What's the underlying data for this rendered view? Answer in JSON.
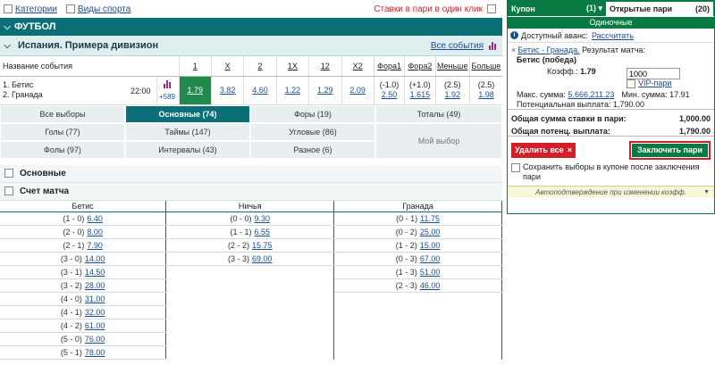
{
  "top": {
    "categories": "Категории",
    "sports": "Виды спорта",
    "one_click": "Ставки в пари в один клик"
  },
  "sport_header": "ФУТБОЛ",
  "league": {
    "title": "Испания. Примера дивизион",
    "all_events": "Все события"
  },
  "odds_table": {
    "headers": [
      "Название события",
      "1",
      "X",
      "2",
      "1X",
      "12",
      "X2",
      "Фора1",
      "Фора2",
      "Меньше",
      "Больше"
    ],
    "team1": "1. Бетис",
    "team2": "2. Гранада",
    "time": "22:00",
    "more_count": "+589",
    "odds": [
      "1.79",
      "3.82",
      "4.60",
      "1.22",
      "1.29",
      "2.09"
    ],
    "hc1_line": "(-1.0)",
    "hc1_val": "2.50",
    "hc2_line": "(+1.0)",
    "hc2_val": "1.615",
    "under_line": "(2.5)",
    "under_val": "1.92",
    "over_line": "(2.5)",
    "over_val": "1.98"
  },
  "market_tabs": [
    "Все выборы",
    "Основные (74)",
    "Форы (19)",
    "Тоталы (49)",
    "Голы (77)",
    "Таймы (147)",
    "Угловые (86)",
    "Мой выбор",
    "Фолы (97)",
    "Интервалы (43)",
    "Разное (6)"
  ],
  "markets": {
    "main": "Основные",
    "score": "Счет матча"
  },
  "score": {
    "headers": [
      "Бетис",
      "Ничья",
      "Гранада"
    ],
    "betis": [
      [
        "(1 - 0)",
        "6.40"
      ],
      [
        "(2 - 0)",
        "8.00"
      ],
      [
        "(2 - 1)",
        "7.90"
      ],
      [
        "(3 - 0)",
        "14.00"
      ],
      [
        "(3 - 1)",
        "14.50"
      ],
      [
        "(3 - 2)",
        "28.00"
      ],
      [
        "(4 - 0)",
        "31.00"
      ],
      [
        "(4 - 1)",
        "32.00"
      ],
      [
        "(4 - 2)",
        "61.00"
      ],
      [
        "(5 - 0)",
        "76.00"
      ],
      [
        "(5 - 1)",
        "78.00"
      ]
    ],
    "draw": [
      [
        "(0 - 0)",
        "9.30"
      ],
      [
        "(1 - 1)",
        "6.55"
      ],
      [
        "(2 - 2)",
        "15.75"
      ],
      [
        "(3 - 3)",
        "69.00"
      ]
    ],
    "granada": [
      [
        "(0 - 1)",
        "11.75"
      ],
      [
        "(0 - 2)",
        "25.00"
      ],
      [
        "(1 - 2)",
        "15.00"
      ],
      [
        "(0 - 3)",
        "67.00"
      ],
      [
        "(1 - 3)",
        "51.00"
      ],
      [
        "(2 - 3)",
        "46.00"
      ]
    ]
  },
  "coupon": {
    "tab1": "Купон",
    "tab1_count": "(1) ▾",
    "tab2": "Открытые пари",
    "tab2_count": "(20)",
    "single": "Одиночные",
    "advance_label": "Доступный аванс:",
    "advance_link": "Рассчитать",
    "event_link": "Бетис - Гранада.",
    "event_result": "Результат матча:",
    "selection": "Бетис (победа)",
    "coef_label": "Коэфф.:",
    "coef": "1.79",
    "stake": "1000",
    "vip": "VIP-пари",
    "max_label": "Макс. сумма:",
    "max_val": "5,666,211.23",
    "min_label": "Мин. сумма:",
    "min_val": "17.91",
    "potential_label": "Потенциальная выплата:",
    "potential_val": "1,790.00",
    "total_stake_label": "Общая сумма ставки в пари:",
    "total_stake_val": "1,000.00",
    "total_pot_label": "Общая потенц. выплата:",
    "total_pot_val": "1,790.00",
    "delete_all": "Удалить все",
    "place": "Заключить пари",
    "keep": "Сохранить выборы в купоне после заключения пари",
    "auto": "Автоподтверждение при изменении коэфф."
  },
  "colors": {
    "header": "#0b6f78",
    "coupon_green": "#0a7a45",
    "selected": "#1f8a4c",
    "accent_red": "#d21f2a"
  }
}
